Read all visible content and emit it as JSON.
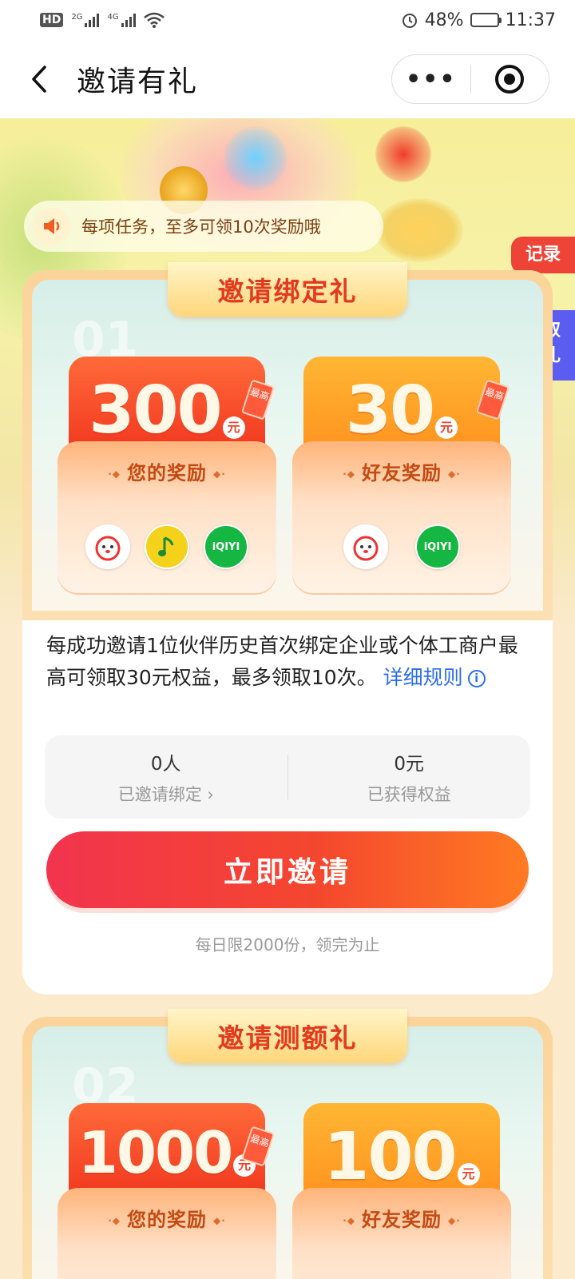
{
  "status_bar": {
    "hd": "HD",
    "net1": "2G",
    "net2": "4G",
    "battery_percent": "48%",
    "battery_level": 0.48,
    "time": "11:37"
  },
  "nav": {
    "title": "邀请有礼",
    "more": "•••"
  },
  "hero": {
    "notice": "每项任务，至多可领10次奖励哦",
    "record_tag": "记录",
    "gift_tag_line1": "领取",
    "gift_tag_line2": "好礼"
  },
  "card1": {
    "title": "邀请绑定礼",
    "ghost": "01",
    "your_reward": {
      "amount": "300",
      "unit": "元",
      "badge": "最高",
      "label": "您的奖励",
      "brands": [
        "JD",
        "QQ音乐",
        "iQIYI"
      ]
    },
    "friend_reward": {
      "amount": "30",
      "unit": "元",
      "badge": "最高",
      "label": "好友奖励",
      "brands": [
        "JD",
        "iQIYI"
      ]
    },
    "description": "每成功邀请1位伙伴历史首次绑定企业或个体工商户最高可领取30元权益，最多领取10次。",
    "rules_link": "详细规则",
    "stats": {
      "invited_value": "0人",
      "invited_label": "已邀请绑定",
      "earned_value": "0元",
      "earned_label": "已获得权益"
    },
    "invite_button": "立即邀请",
    "daily_limit": "每日限2000份，领完为止"
  },
  "card2": {
    "title": "邀请测额礼",
    "ghost": "02",
    "your_reward": {
      "amount": "1000",
      "unit": "元",
      "badge": "最高",
      "label": "您的奖励"
    },
    "friend_reward": {
      "amount": "100",
      "unit": "元",
      "label": "好友奖励"
    }
  }
}
